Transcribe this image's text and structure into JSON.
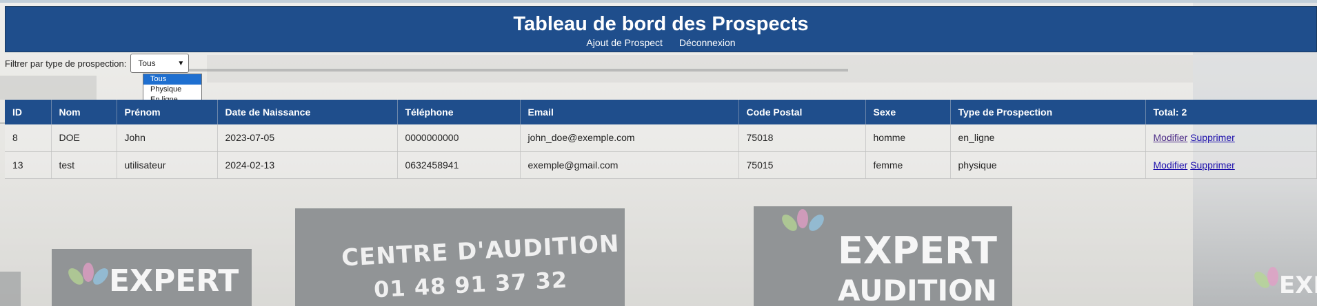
{
  "header": {
    "title": "Tableau de bord des Prospects",
    "nav": [
      "Ajout de Prospect",
      "Déconnexion"
    ]
  },
  "filter": {
    "label": "Filtrer par type de prospection:",
    "selected": "Tous",
    "options": [
      "Tous",
      "Physique",
      "En ligne"
    ]
  },
  "table": {
    "headers": [
      "ID",
      "Nom",
      "Prénom",
      "Date de Naissance",
      "Téléphone",
      "Email",
      "Code Postal",
      "Sexe",
      "Type de Prospection",
      "Total: 2"
    ],
    "rows": [
      [
        "8",
        "DOE",
        "John",
        "2023-07-05",
        "0000000000",
        "john_doe@exemple.com",
        "75018",
        "homme",
        "en_ligne"
      ],
      [
        "13",
        "test",
        "utilisateur",
        "2024-02-13",
        "0632458941",
        "exemple@gmail.com",
        "75015",
        "femme",
        "physique"
      ]
    ],
    "actions": {
      "edit": "Modifier",
      "delete": "Supprimer"
    }
  },
  "background": {
    "sign_centre": "CENTRE D'AUDITION",
    "sign_phone": "01 48 91 37 32",
    "logo_word1": "EXPERT",
    "logo_word2": "AUDITION"
  },
  "colors": {
    "header_bg": "#1f4e8c",
    "link": "#1a0dab",
    "selected_option": "#1e6fd0"
  }
}
